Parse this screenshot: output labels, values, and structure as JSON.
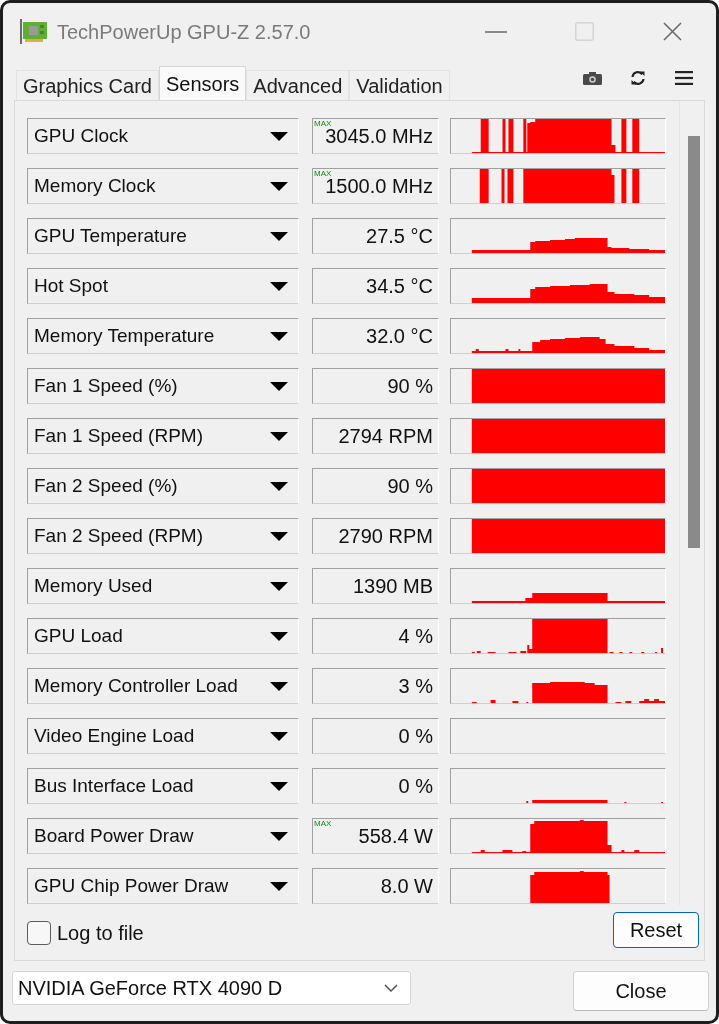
{
  "window": {
    "title": "TechPowerUp GPU-Z 2.57.0",
    "maximize_disabled": true
  },
  "tabs": [
    {
      "label": "Graphics Card",
      "selected": false
    },
    {
      "label": "Sensors",
      "selected": true
    },
    {
      "label": "Advanced",
      "selected": false
    },
    {
      "label": "Validation",
      "selected": false
    }
  ],
  "sensors": [
    {
      "name": "GPU Clock",
      "marker": "MAX",
      "value": "3045.0 MHz"
    },
    {
      "name": "Memory Clock",
      "marker": "MAX",
      "value": "1500.0 MHz"
    },
    {
      "name": "GPU Temperature",
      "value": "27.5 °C"
    },
    {
      "name": "Hot Spot",
      "value": "34.5 °C"
    },
    {
      "name": "Memory Temperature",
      "value": "32.0 °C"
    },
    {
      "name": "Fan 1 Speed (%)",
      "value": "90 %"
    },
    {
      "name": "Fan 1 Speed (RPM)",
      "value": "2794 RPM"
    },
    {
      "name": "Fan 2 Speed (%)",
      "value": "90 %"
    },
    {
      "name": "Fan 2 Speed (RPM)",
      "value": "2790 RPM"
    },
    {
      "name": "Memory Used",
      "value": "1390 MB"
    },
    {
      "name": "GPU Load",
      "value": "4 %"
    },
    {
      "name": "Memory Controller Load",
      "value": "3 %"
    },
    {
      "name": "Video Engine Load",
      "value": "0 %"
    },
    {
      "name": "Bus Interface Load",
      "value": "0 %"
    },
    {
      "name": "Board Power Draw",
      "marker": "MAX",
      "value": "558.4 W"
    },
    {
      "name": "GPU Chip Power Draw",
      "value": "8.0 W"
    }
  ],
  "log_to_file": {
    "label": "Log to file",
    "checked": false
  },
  "reset_button": "Reset",
  "device_select": {
    "value": "NVIDIA GeForce RTX 4090 D"
  },
  "close_button": "Close"
}
